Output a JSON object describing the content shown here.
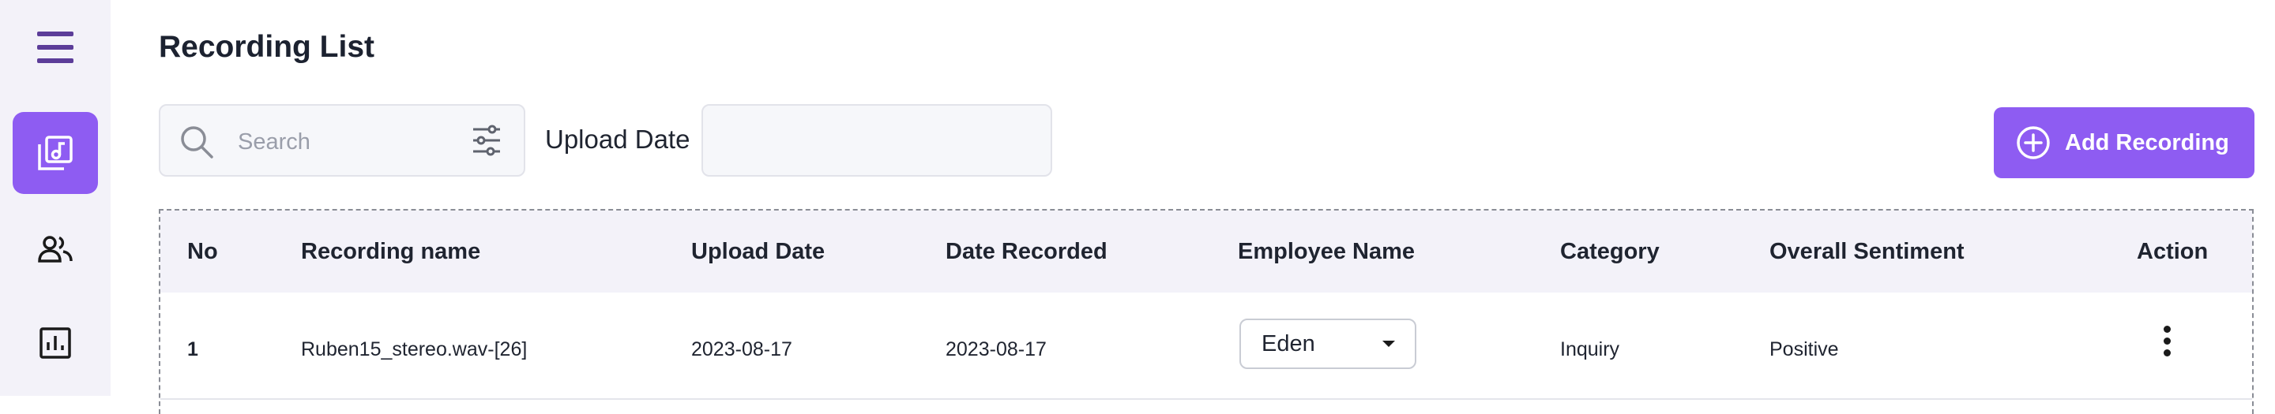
{
  "app": {
    "page_title": "Recording List"
  },
  "sidebar": {
    "items": [
      {
        "name": "menu",
        "icon": "hamburger-menu-icon",
        "active": false
      },
      {
        "name": "recordings",
        "icon": "music-library-icon",
        "active": true
      },
      {
        "name": "users",
        "icon": "users-icon",
        "active": false
      },
      {
        "name": "reports",
        "icon": "bar-chart-icon",
        "active": false
      }
    ]
  },
  "toolbar": {
    "search_placeholder": "Search",
    "search_value": "",
    "upload_date_label": "Upload Date",
    "upload_date_value": "",
    "add_recording_label": "Add Recording"
  },
  "table": {
    "columns": [
      "No",
      "Recording name",
      "Upload Date",
      "Date Recorded",
      "Employee Name",
      "Category",
      "Overall Sentiment",
      "Action"
    ],
    "rows": [
      {
        "no": "1",
        "recording_name": "Ruben15_stereo.wav-[26]",
        "upload_date": "2023-08-17",
        "date_recorded": "2023-08-17",
        "employee_name": "Eden",
        "category": "Inquiry",
        "sentiment": "Positive"
      }
    ]
  },
  "colors": {
    "accent": "#8e5cf2",
    "sidebar_bg": "#f3f2f9",
    "menu_icon": "#5c3d99"
  }
}
